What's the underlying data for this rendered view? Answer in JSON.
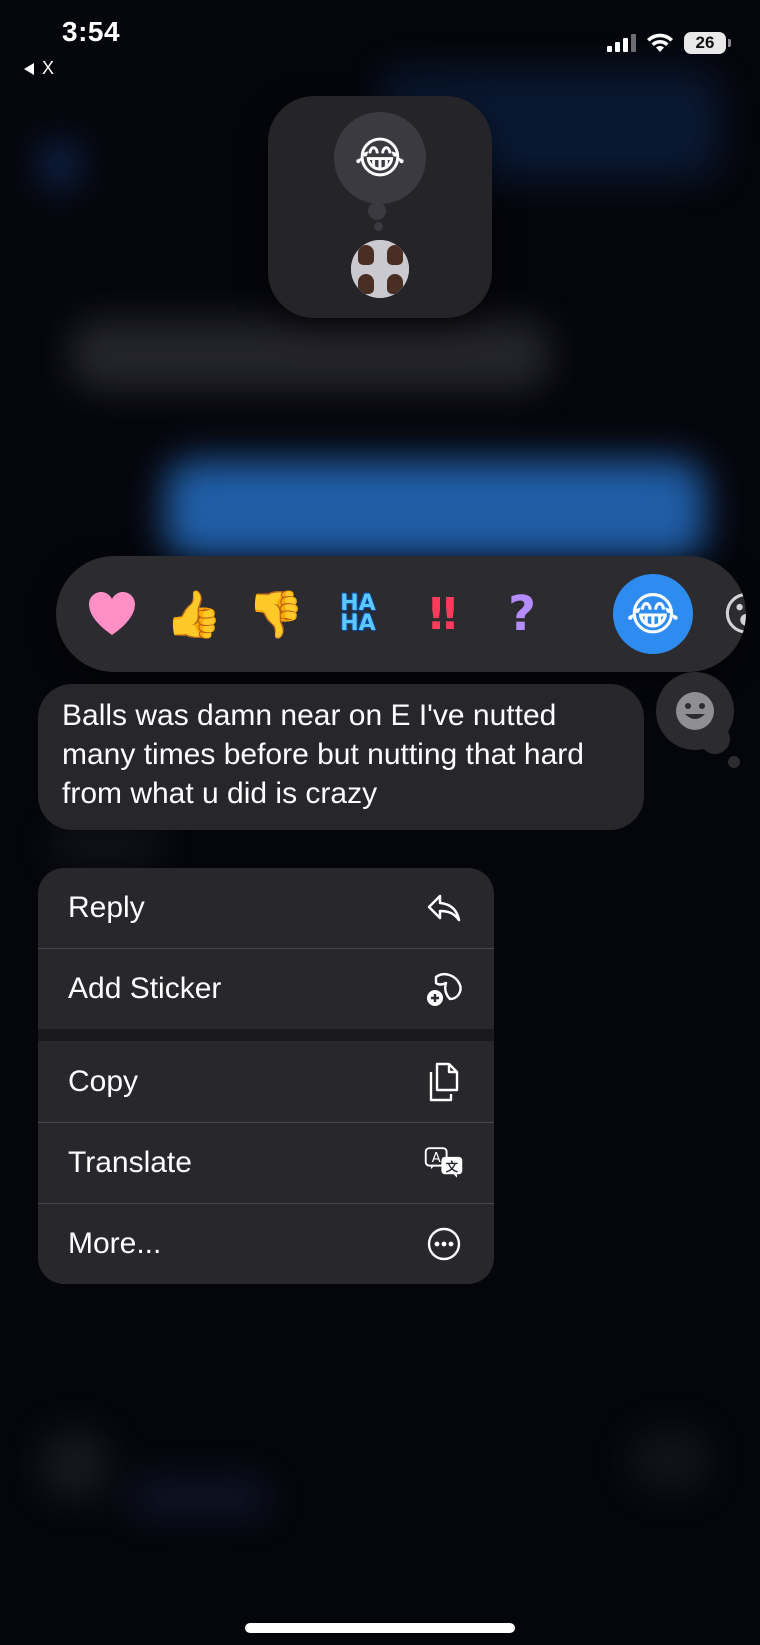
{
  "status_bar": {
    "time": "3:54",
    "back_label": "X",
    "battery_level": "26"
  },
  "reaction_card": {
    "reaction_emoji": "😂"
  },
  "tapback": {
    "items": [
      {
        "name": "heart",
        "glyph": "🩷"
      },
      {
        "name": "thumbs-up",
        "glyph": "👍"
      },
      {
        "name": "thumbs-down",
        "glyph": "👎"
      },
      {
        "name": "haha",
        "glyph": "HA\nHA"
      },
      {
        "name": "exclamation",
        "glyph": "‼"
      },
      {
        "name": "question",
        "glyph": "?"
      },
      {
        "name": "laughing",
        "glyph": "😂",
        "selected": true
      },
      {
        "name": "partial-emoji",
        "glyph": "😮"
      }
    ]
  },
  "message": {
    "text": "Balls was damn near on E I've nutted many times before but nutting that hard from what u did is crazy"
  },
  "menu": {
    "reply": "Reply",
    "add_sticker": "Add Sticker",
    "copy": "Copy",
    "translate": "Translate",
    "more": "More..."
  },
  "colors": {
    "accent": "#2e8cf0",
    "bubble": "#26262b",
    "menu": "#27272c"
  }
}
